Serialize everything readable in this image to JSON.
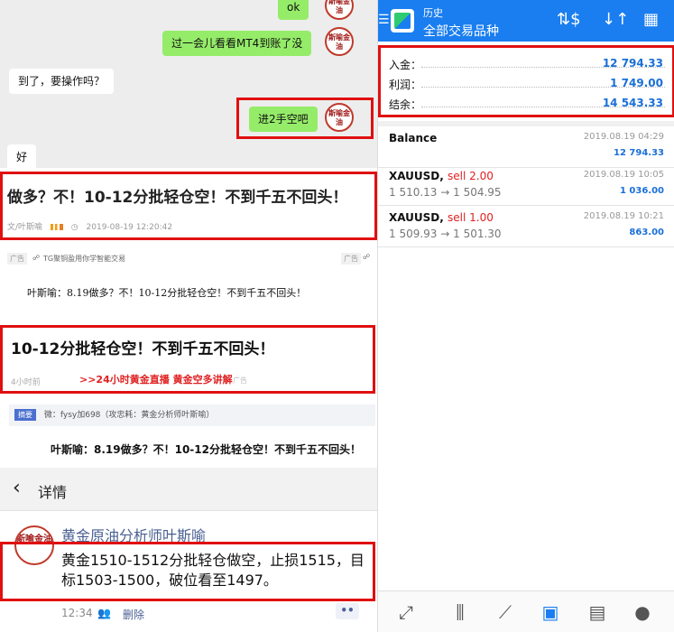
{
  "chat": {
    "msg_ok": "ok",
    "msg_check_mt4": "过一会儿看看MT4到账了没",
    "msg_arrived": "到了，要操作吗？",
    "msg_short": "进2手空吧",
    "msg_good": "好",
    "avatar_text": "斯喻金油"
  },
  "article1": {
    "title": "做多？不！10-12分批轻仓空！不到千五不回头！",
    "author": "文/叶斯喻",
    "date": "2019-08-19 12:20:42"
  },
  "ad": {
    "tag": "广告",
    "text": "TG聚铜盈用你学智能交易"
  },
  "article_line": "叶斯喻：8.19做多？不！10-12分批轻仓空！不到千五不回头！",
  "article2": {
    "title": "10-12分批轻仓空！不到千五不回头！",
    "ago": "4小时前",
    "promo": ">>24小时黄金直播 黄金空多讲解",
    "adtag": "广告"
  },
  "excerpt": {
    "tag": "摘要",
    "text": "微：fysy加698（攻忠耗：黄金分析师叶斯喻）"
  },
  "article_line2": "叶斯喻：8.19做多？不！10-12分批轻仓空！不到千五不回头！",
  "detail": {
    "back_icon": "‹",
    "title": "详情",
    "author": "黄金原油分析师叶斯喻",
    "body": "黄金1510-1512分批轻仓做空，止损1515，目标1503-1500，破位看至1497。",
    "time": "12:34",
    "delete": "删除",
    "more": "••"
  },
  "app": {
    "subtitle": "历史",
    "title": "全部交易品种",
    "summary": [
      {
        "label": "入金：",
        "value": "12 794.33"
      },
      {
        "label": "利润：",
        "value": "1 749.00"
      },
      {
        "label": "结余：",
        "value": "14 543.33"
      }
    ],
    "deals": [
      {
        "symbol": "Balance",
        "side": "",
        "prices": "",
        "date": "2019.08.19 04:29",
        "amount": "12 794.33"
      },
      {
        "symbol": "XAUUSD, ",
        "side": "sell 2.00",
        "prices": "1 510.13 → 1 504.95",
        "date": "2019.08.19 10:05",
        "amount": "1 036.00"
      },
      {
        "symbol": "XAUUSD, ",
        "side": "sell 1.00",
        "prices": "1 509.93 → 1 501.30",
        "date": "2019.08.19 10:21",
        "amount": "863.00"
      }
    ]
  },
  "colors": {
    "accent": "#1a7ef0",
    "highlight_box": "#e01010",
    "sell": "#e02020",
    "chat_green": "#95ec69"
  }
}
